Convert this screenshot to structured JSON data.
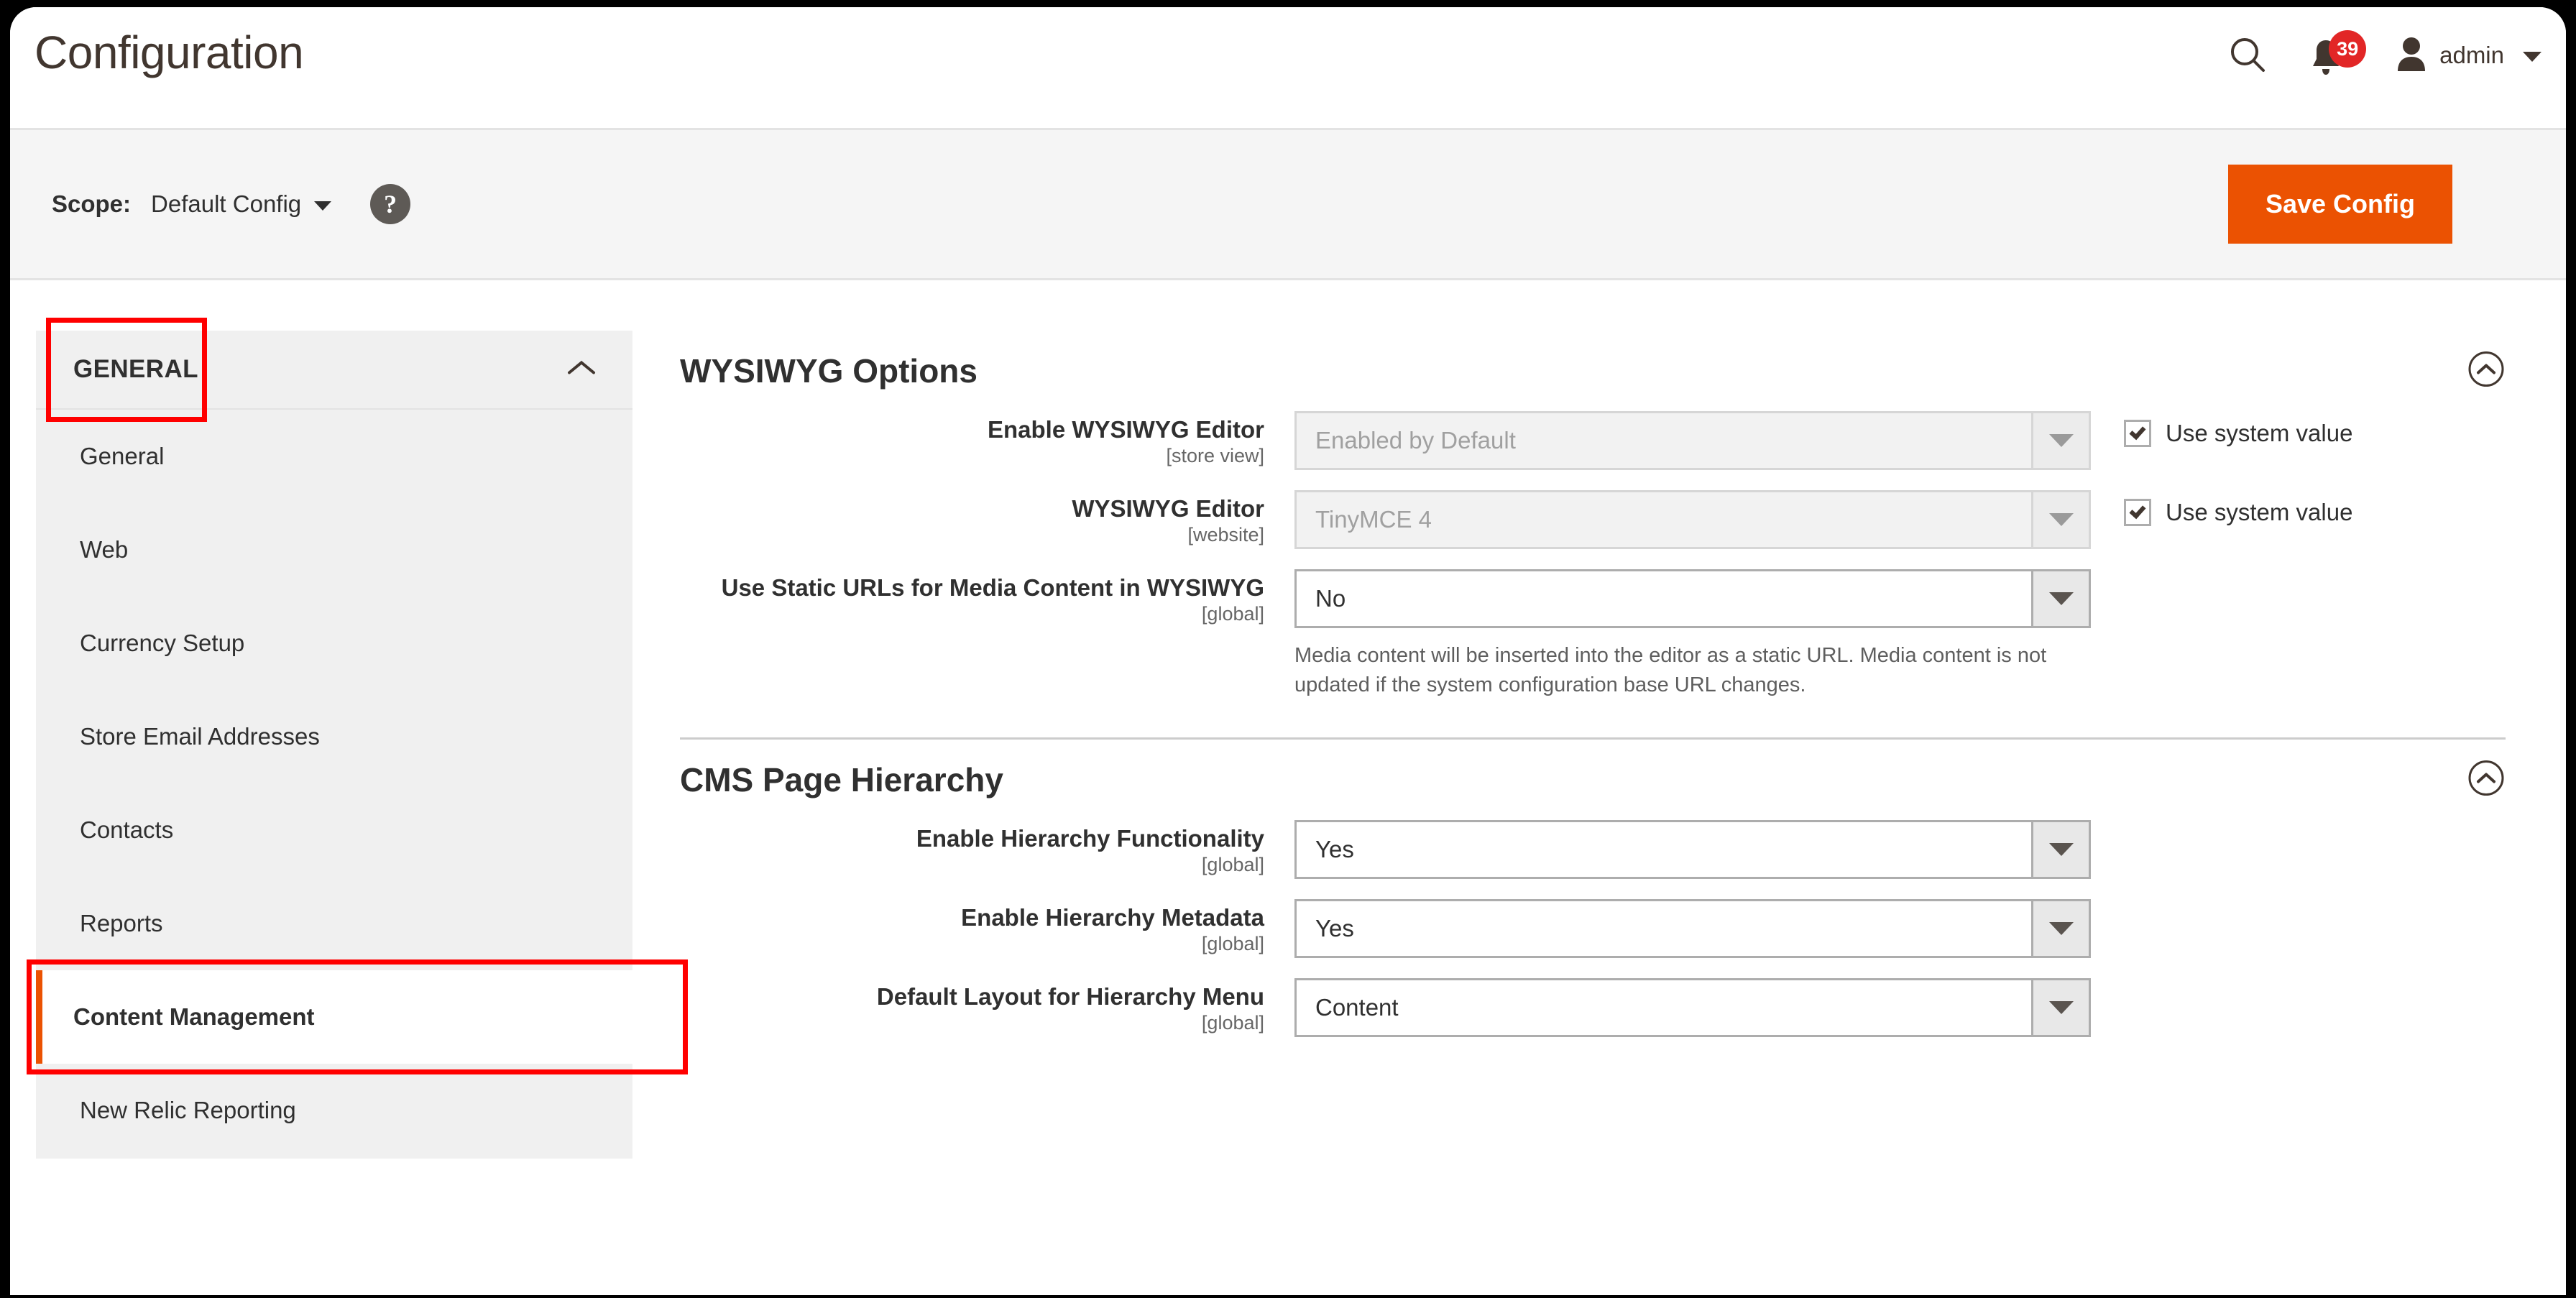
{
  "header": {
    "title": "Configuration",
    "search_icon": "search-icon",
    "bell_icon": "bell-icon",
    "notification_count": "39",
    "user_icon": "user-avatar-icon",
    "user_name": "admin",
    "user_caret_icon": "chevron-down-icon"
  },
  "scope_bar": {
    "label": "Scope:",
    "value": "Default Config",
    "caret_icon": "chevron-down-icon",
    "help_icon": "?",
    "save_label": "Save Config",
    "accent_color": "#eb5202"
  },
  "sidebar": {
    "section_title": "GENERAL",
    "section_chevron_icon": "chevron-up-icon",
    "items": [
      {
        "label": "General",
        "active": false
      },
      {
        "label": "Web",
        "active": false
      },
      {
        "label": "Currency Setup",
        "active": false
      },
      {
        "label": "Store Email Addresses",
        "active": false
      },
      {
        "label": "Contacts",
        "active": false
      },
      {
        "label": "Reports",
        "active": false
      },
      {
        "label": "Content Management",
        "active": true
      },
      {
        "label": "New Relic Reporting",
        "active": false
      }
    ],
    "annotation_color": "#ff0000"
  },
  "main": {
    "sections": [
      {
        "title": "WYSIWYG Options",
        "chevron_icon": "chevron-up-icon",
        "fields": [
          {
            "label": "Enable WYSIWYG Editor",
            "scope": "[store view]",
            "value": "Enabled by Default",
            "disabled": true,
            "arrow_icon": "caret-down-icon",
            "use_system_value": {
              "label": "Use system value",
              "checked": true
            }
          },
          {
            "label": "WYSIWYG Editor",
            "scope": "[website]",
            "value": "TinyMCE 4",
            "disabled": true,
            "arrow_icon": "caret-down-icon",
            "use_system_value": {
              "label": "Use system value",
              "checked": true
            }
          },
          {
            "label": "Use Static URLs for Media Content in WYSIWYG",
            "scope": "[global]",
            "value": "No",
            "disabled": false,
            "arrow_icon": "caret-down-icon",
            "note": "Media content will be inserted into the editor as a static URL. Media content is not updated if the system configuration base URL changes."
          }
        ]
      },
      {
        "title": "CMS Page Hierarchy",
        "chevron_icon": "chevron-up-icon",
        "fields": [
          {
            "label": "Enable Hierarchy Functionality",
            "scope": "[global]",
            "value": "Yes",
            "disabled": false,
            "arrow_icon": "caret-down-icon"
          },
          {
            "label": "Enable Hierarchy Metadata",
            "scope": "[global]",
            "value": "Yes",
            "disabled": false,
            "arrow_icon": "caret-down-icon"
          },
          {
            "label": "Default Layout for Hierarchy Menu",
            "scope": "[global]",
            "value": "Content",
            "disabled": false,
            "arrow_icon": "caret-down-icon"
          }
        ]
      }
    ]
  }
}
